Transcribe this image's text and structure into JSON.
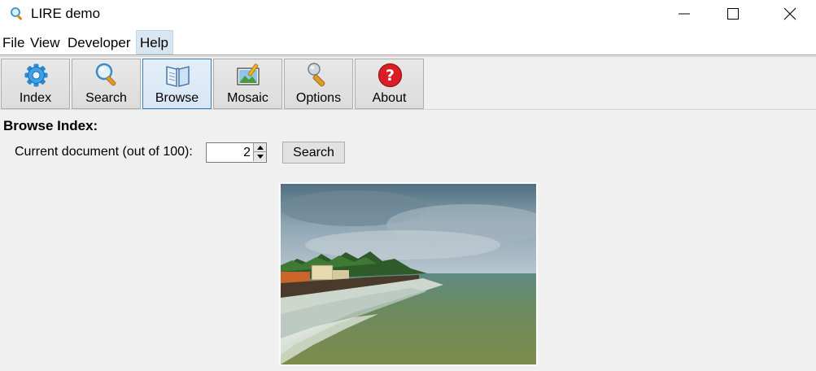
{
  "window": {
    "title": "LIRE demo",
    "title_icon": "magnifier-icon",
    "controls": [
      "minimize-icon",
      "maximize-icon",
      "close-icon"
    ]
  },
  "menu": {
    "items": [
      "File",
      "View",
      "Developer",
      "Help"
    ],
    "active": "Help"
  },
  "toolbar": {
    "buttons": [
      {
        "label": "Index",
        "icon": "gear-icon"
      },
      {
        "label": "Search",
        "icon": "magnifier-icon"
      },
      {
        "label": "Browse",
        "icon": "book-icon"
      },
      {
        "label": "Mosaic",
        "icon": "image-edit-icon"
      },
      {
        "label": "Options",
        "icon": "wrench-icon"
      },
      {
        "label": "About",
        "icon": "help-icon"
      }
    ],
    "active": "Browse"
  },
  "browse": {
    "title": "Browse Index:",
    "doc_label": "Current document  (out of 100):",
    "current_document": "2",
    "search_label": "Search"
  },
  "preview": {
    "image": "coastal-landscape-photo"
  }
}
